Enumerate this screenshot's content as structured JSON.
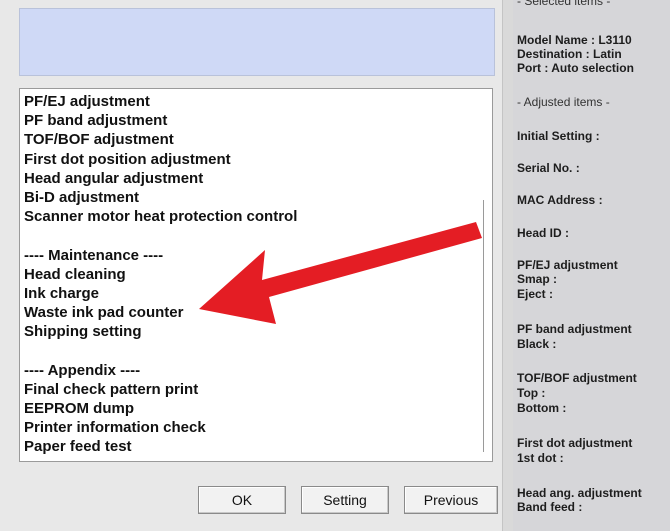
{
  "main": {
    "list": {
      "groups": [
        {
          "header": "",
          "items": [
            "PF/EJ adjustment",
            "PF band adjustment",
            "TOF/BOF adjustment",
            "First dot position adjustment",
            "Head angular adjustment",
            "Bi-D adjustment",
            "Scanner motor heat protection control"
          ]
        },
        {
          "header": "---- Maintenance ----",
          "items": [
            "Head cleaning",
            "Ink charge",
            "Waste ink pad counter",
            "Shipping setting"
          ]
        },
        {
          "header": "---- Appendix ----",
          "items": [
            "Final check pattern print",
            "EEPROM dump",
            "Printer information check",
            "Paper feed test"
          ]
        }
      ]
    },
    "buttons": {
      "ok": "OK",
      "setting": "Setting",
      "previous": "Previous"
    },
    "annotation_color": "#e41d24"
  },
  "side": {
    "selected_heading": "- Selected items -",
    "model_name": "Model Name : L3110",
    "destination": "Destination : Latin",
    "port": "Port : Auto selection",
    "adjusted_heading": "- Adjusted items -",
    "initial_setting": "Initial Setting :",
    "serial_no": "Serial No. :",
    "mac_address": "MAC Address :",
    "head_id": "Head ID :",
    "pfej_adjustment": "PF/EJ adjustment",
    "smap": " Smap :",
    "eject": " Eject :",
    "pf_band_adjustment": "PF band adjustment",
    "black": " Black :",
    "tofbof_adjustment": "TOF/BOF adjustment",
    "top": " Top :",
    "bottom": " Bottom :",
    "first_dot_adjustment": "First dot adjustment",
    "first_dot": " 1st dot :",
    "head_ang_adjustment": "Head ang. adjustment",
    "band_feed": " Band feed :"
  }
}
